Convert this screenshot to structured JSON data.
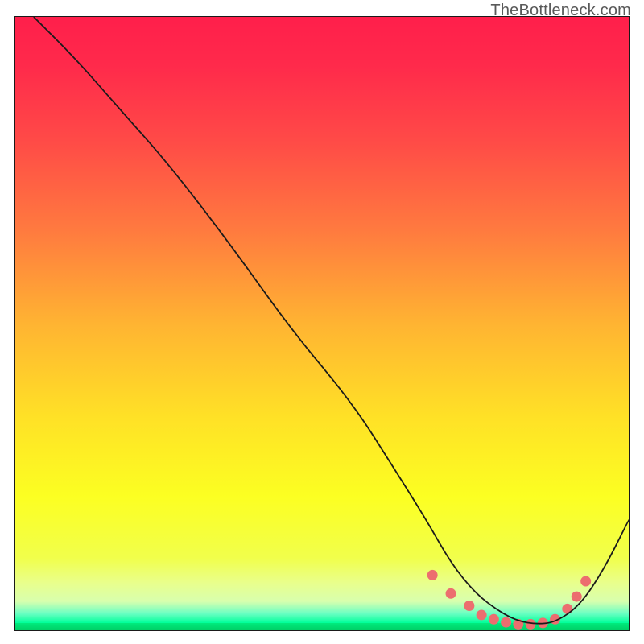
{
  "watermark": "TheBottleneck.com",
  "chart_data": {
    "type": "line",
    "title": "",
    "xlabel": "",
    "ylabel": "",
    "xlim": [
      0,
      100
    ],
    "ylim": [
      0,
      100
    ],
    "grid": false,
    "legend": false,
    "gradient_bands": [
      {
        "y0": 0,
        "y1": 8,
        "color_top": "#ff1f4b",
        "color_bottom": "#ff2a4b"
      },
      {
        "y0": 8,
        "y1": 20,
        "color_top": "#ff2a4b",
        "color_bottom": "#ff4a47"
      },
      {
        "y0": 20,
        "y1": 35,
        "color_top": "#ff4a47",
        "color_bottom": "#ff7b3f"
      },
      {
        "y0": 35,
        "y1": 50,
        "color_top": "#ff7b3f",
        "color_bottom": "#ffb432"
      },
      {
        "y0": 50,
        "y1": 65,
        "color_top": "#ffb432",
        "color_bottom": "#ffe126"
      },
      {
        "y0": 65,
        "y1": 78,
        "color_top": "#ffe126",
        "color_bottom": "#fcff22"
      },
      {
        "y0": 78,
        "y1": 88,
        "color_top": "#fcff22",
        "color_bottom": "#f1ff4b"
      },
      {
        "y0": 88,
        "y1": 92,
        "color_top": "#f1ff4b",
        "color_bottom": "#e9ff8c"
      },
      {
        "y0": 92,
        "y1": 95,
        "color_top": "#e9ff8c",
        "color_bottom": "#d8ffae"
      },
      {
        "y0": 95,
        "y1": 97,
        "color_top": "#d8ffae",
        "color_bottom": "#6bffc3"
      },
      {
        "y0": 97,
        "y1": 98.5,
        "color_top": "#6bffc3",
        "color_bottom": "#00ff9a"
      },
      {
        "y0": 98.5,
        "y1": 100,
        "color_top": "#00eb7d",
        "color_bottom": "#00c860"
      }
    ],
    "series": [
      {
        "name": "bottleneck-curve",
        "type": "line",
        "color": "#1a1a1a",
        "x": [
          3,
          10,
          17,
          25,
          35,
          45,
          55,
          62,
          67,
          71,
          75,
          79,
          82,
          85,
          88,
          92,
          96,
          100
        ],
        "y": [
          100,
          93,
          85,
          76,
          63,
          49,
          37,
          26,
          18,
          11,
          6,
          3,
          1.5,
          1,
          1.3,
          4,
          10,
          18
        ]
      },
      {
        "name": "highlight-dots",
        "type": "scatter",
        "color": "#ec6e6f",
        "x": [
          68,
          71,
          74,
          76,
          78,
          80,
          82,
          84,
          86,
          88,
          90,
          91.5,
          93
        ],
        "y": [
          9,
          6,
          4,
          2.5,
          1.8,
          1.3,
          1.0,
          1.0,
          1.2,
          1.8,
          3.5,
          5.5,
          8
        ]
      }
    ]
  }
}
